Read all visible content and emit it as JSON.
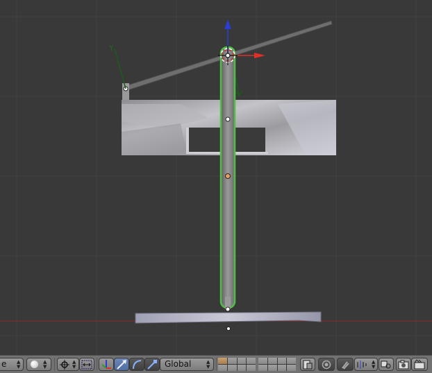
{
  "viewport": {
    "background": "#393939",
    "grid_color": "#414141",
    "x_axis_color": "#8c2d2d",
    "selection_outline_color": "#4fbf47",
    "gizmo": {
      "x_color": "#e0302a",
      "z_color": "#2c3ed0"
    }
  },
  "header": {
    "mode_select": {
      "visible_text": "e"
    },
    "shading_icon": "sphere-shading-icon",
    "pivot_icon": "pivot-point-icon",
    "widget_toggle_icon": "manipulator-toggle-icon",
    "transform_icons": [
      "translate-arrows-icon",
      "move-arrow-icon",
      "rotate-arc-icon",
      "scale-arrow-icon"
    ],
    "orientation": {
      "label": "Global"
    },
    "layer_blocks": 2,
    "right_icons": [
      "proportional-edit-icon",
      "snap-icon",
      "snap-target-icon",
      "magnet-icon",
      "snap-element-icon",
      "render-camera-icon",
      "render-anim-icon"
    ]
  }
}
